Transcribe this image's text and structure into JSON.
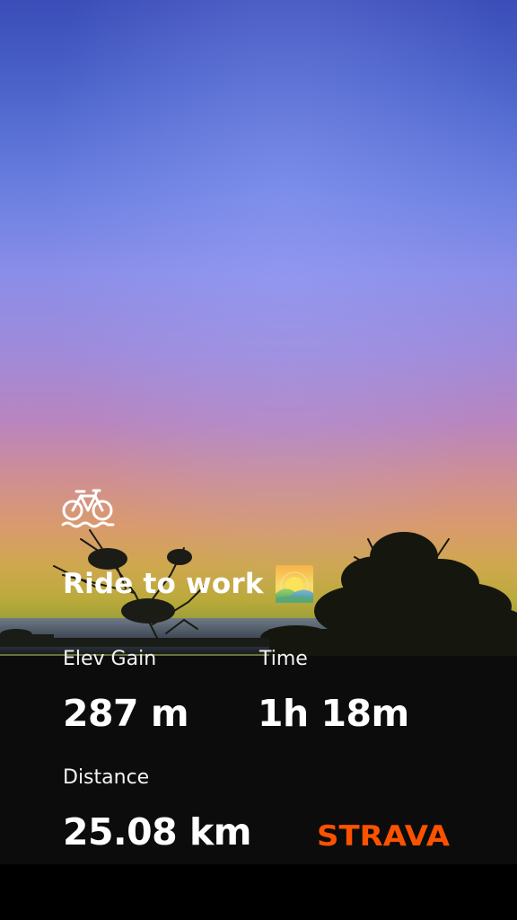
{
  "activity": {
    "type_icon": "bike-icon",
    "title": "Ride to work",
    "title_emoji_icon": "sunrise-icon"
  },
  "stats": {
    "elev_gain": {
      "label": "Elev Gain",
      "value": "287 m"
    },
    "time": {
      "label": "Time",
      "value": "1h 18m"
    },
    "distance": {
      "label": "Distance",
      "value": "25.08 km"
    }
  },
  "brand": {
    "logo_text": "STRAVA",
    "color": "#fc5200"
  },
  "colors": {
    "panel": "#0c0c0c",
    "text": "#ffffff",
    "sky_top": "#3b4db8",
    "sky_horizon": "#cfa84e"
  }
}
